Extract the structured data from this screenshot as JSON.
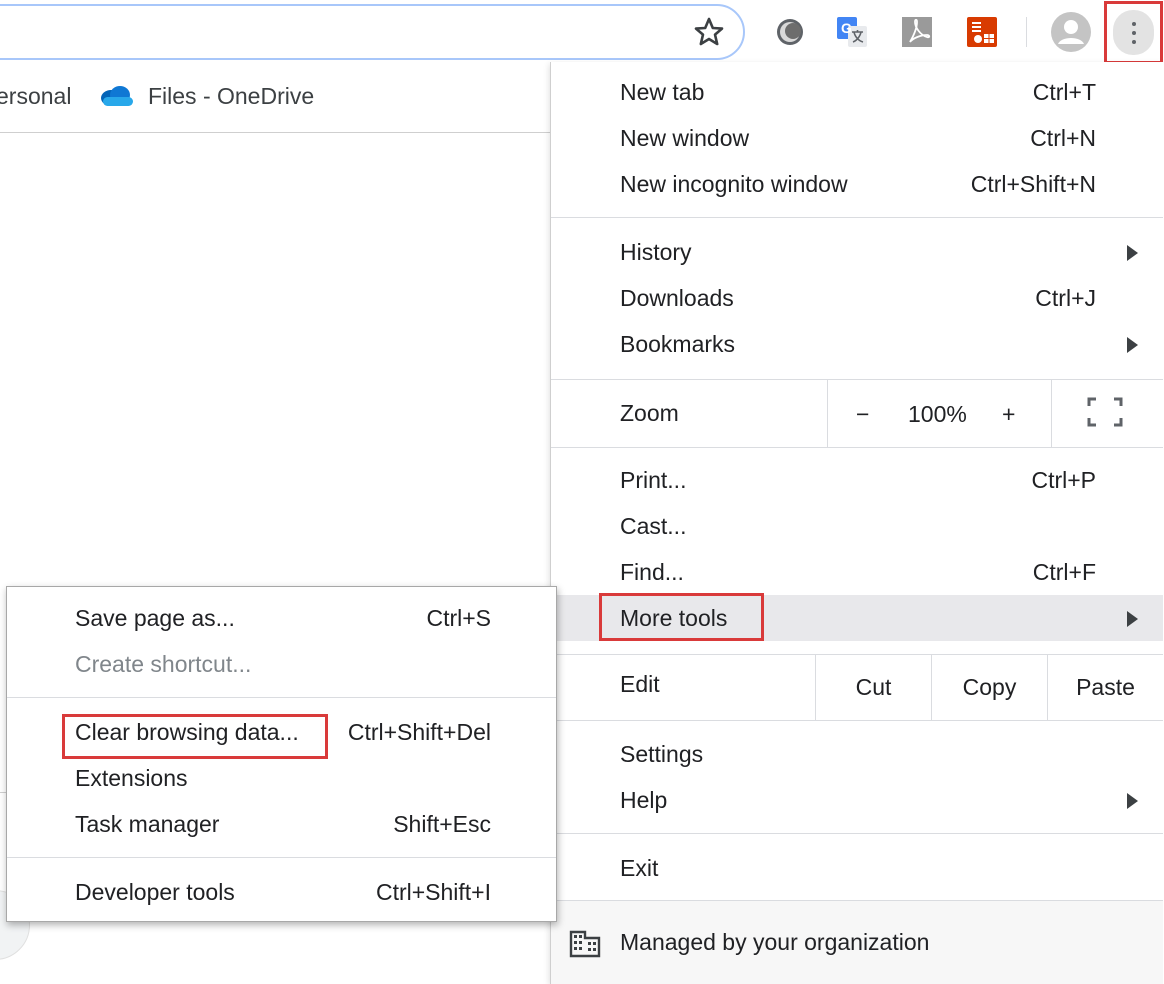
{
  "toolbar": {
    "icons": [
      "star-icon",
      "circle-extension-icon",
      "google-translate-icon",
      "acrobat-icon",
      "office-extension-icon",
      "profile-avatar-icon",
      "menu-kebab-icon"
    ],
    "google_translate_glyph": "G"
  },
  "bookmarks": {
    "items": [
      {
        "label": "ersonal"
      },
      {
        "label": "Files - OneDrive",
        "icon": "onedrive-cloud-icon"
      }
    ]
  },
  "menu": {
    "new_tab": {
      "label": "New tab",
      "shortcut": "Ctrl+T"
    },
    "new_window": {
      "label": "New window",
      "shortcut": "Ctrl+N"
    },
    "new_incognito": {
      "label": "New incognito window",
      "shortcut": "Ctrl+Shift+N"
    },
    "history": {
      "label": "History"
    },
    "downloads": {
      "label": "Downloads",
      "shortcut": "Ctrl+J"
    },
    "bookmarks": {
      "label": "Bookmarks"
    },
    "zoom": {
      "label": "Zoom",
      "minus": "−",
      "value": "100%",
      "plus": "+"
    },
    "print": {
      "label": "Print...",
      "shortcut": "Ctrl+P"
    },
    "cast": {
      "label": "Cast..."
    },
    "find": {
      "label": "Find...",
      "shortcut": "Ctrl+F"
    },
    "more_tools": {
      "label": "More tools"
    },
    "edit": {
      "label": "Edit",
      "cut": "Cut",
      "copy": "Copy",
      "paste": "Paste"
    },
    "settings": {
      "label": "Settings"
    },
    "help": {
      "label": "Help"
    },
    "exit": {
      "label": "Exit"
    },
    "managed": {
      "label": "Managed by your organization"
    }
  },
  "submenu": {
    "save_page": {
      "label": "Save page as...",
      "shortcut": "Ctrl+S"
    },
    "create_shortcut": {
      "label": "Create shortcut..."
    },
    "clear_browsing": {
      "label": "Clear browsing data...",
      "shortcut": "Ctrl+Shift+Del"
    },
    "extensions": {
      "label": "Extensions"
    },
    "task_manager": {
      "label": "Task manager",
      "shortcut": "Shift+Esc"
    },
    "developer_tools": {
      "label": "Developer tools",
      "shortcut": "Ctrl+Shift+I"
    }
  },
  "colors": {
    "highlight_border": "#d93a3a",
    "hover_background": "#e8e8eb",
    "omnibox_border": "#a8c7fa",
    "translate_blue": "#4285f4",
    "office_orange": "#d83b01",
    "onedrive_blue": "#0f78d4"
  }
}
